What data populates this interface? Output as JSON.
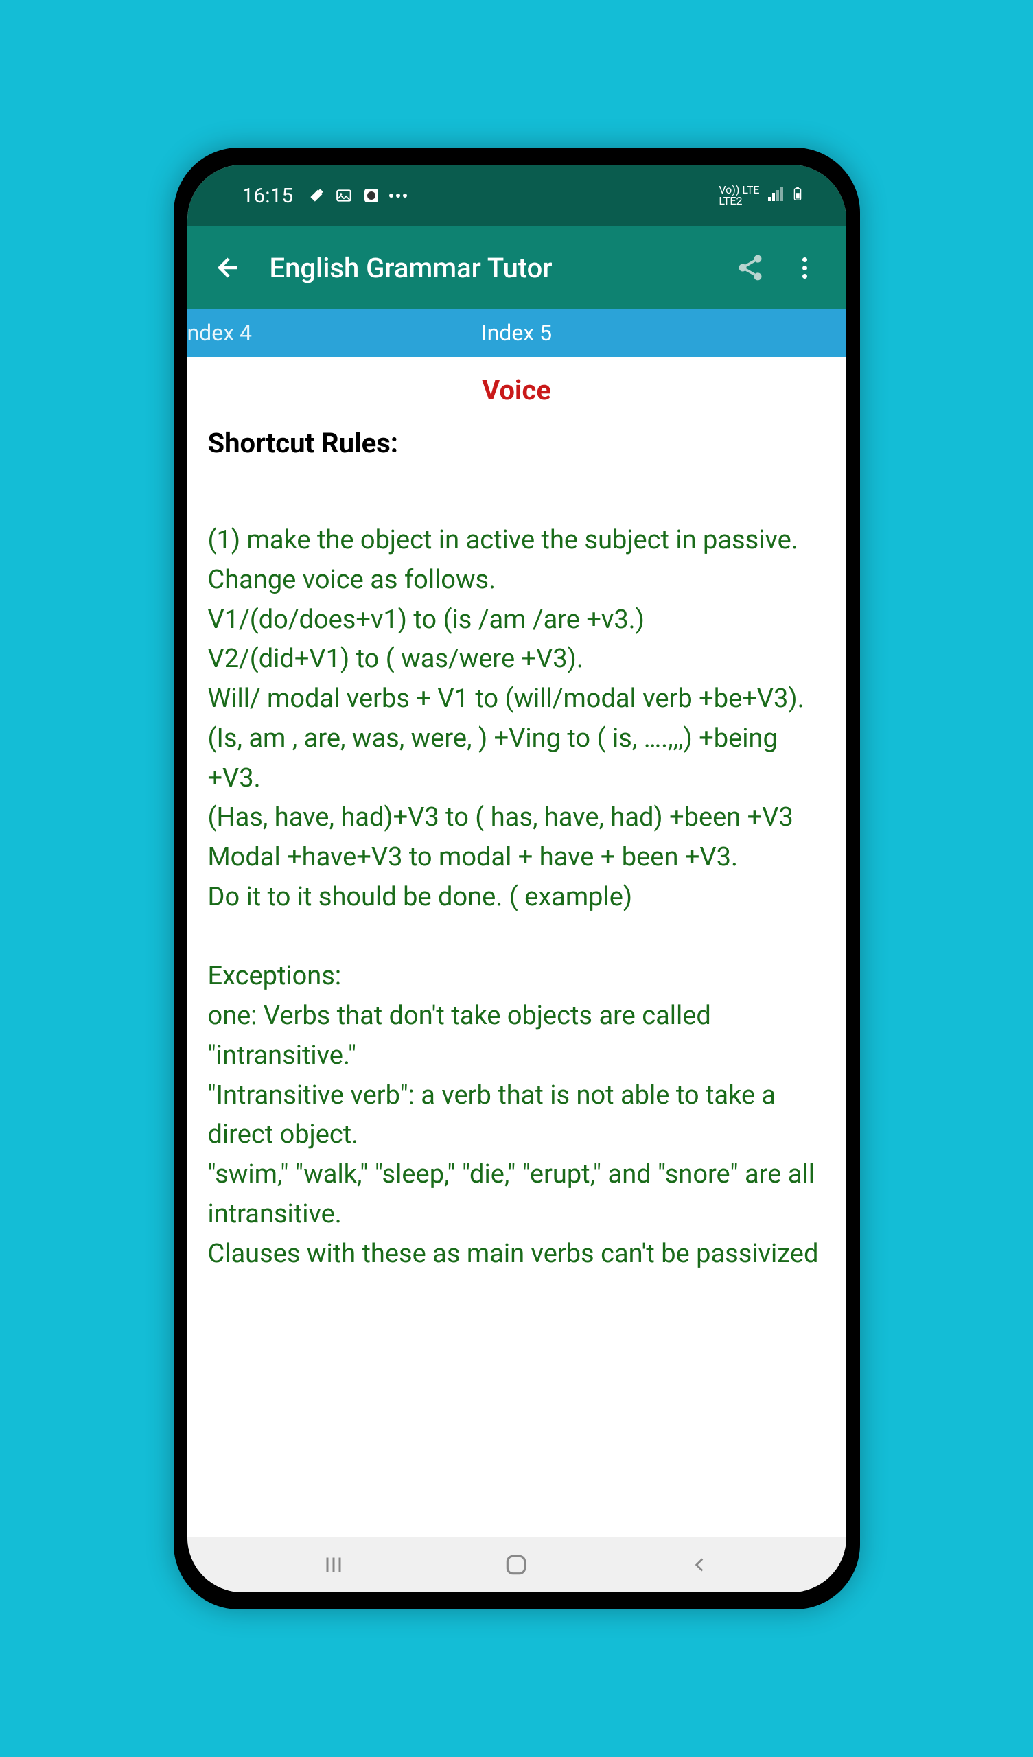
{
  "statusBar": {
    "time": "16:15",
    "networkLabel": "Vo)) LTE",
    "networkSub": "LTE2"
  },
  "appBar": {
    "title": "English Grammar Tutor"
  },
  "tabs": {
    "left": "ndex 4",
    "center": "Index 5"
  },
  "content": {
    "title": "Voice",
    "subtitle": "Shortcut Rules:",
    "body": "(1) make the object in active the subject in passive.\nChange voice as follows.\nV1/(do/does+v1) to (is /am /are +v3.)\nV2/(did+V1) to ( was/were +V3).\nWill/ modal verbs + V1 to (will/modal verb +be+V3).\n(Is, am , are, was, were, ) +Ving to ( is, ….,,,) +being +V3.\n(Has, have, had)+V3 to ( has, have, had) +been +V3\nModal +have+V3 to modal + have + been +V3.\nDo it to it should be done. ( example)\n\nExceptions:\none: Verbs that don't take objects are called \"intransitive.\"\n\"Intransitive verb\": a verb that is not able to take a direct object.\n\"swim,\" \"walk,\" \"sleep,\" \"die,\" \"erupt,\" and \"snore\" are all intransitive.\nClauses with these as main verbs can't be passivized"
  }
}
